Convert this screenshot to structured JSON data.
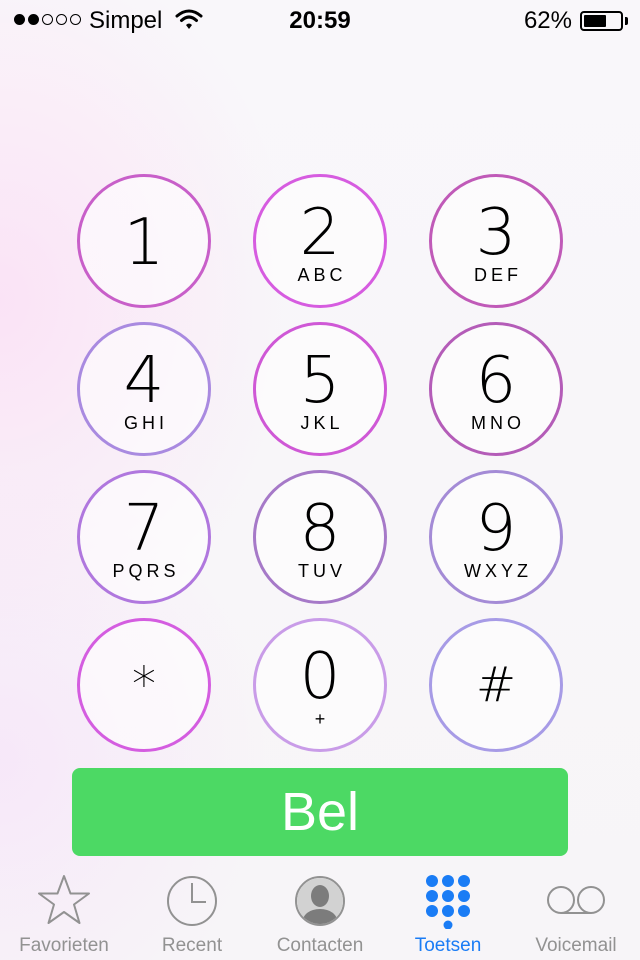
{
  "status_bar": {
    "signal_filled": 2,
    "signal_total": 5,
    "carrier": "Simpel",
    "time": "20:59",
    "battery_percent": "62%",
    "battery_level": 0.62
  },
  "keypad": [
    {
      "digit": "1",
      "letters": ""
    },
    {
      "digit": "2",
      "letters": "ABC"
    },
    {
      "digit": "3",
      "letters": "DEF"
    },
    {
      "digit": "4",
      "letters": "GHI"
    },
    {
      "digit": "5",
      "letters": "JKL"
    },
    {
      "digit": "6",
      "letters": "MNO"
    },
    {
      "digit": "7",
      "letters": "PQRS"
    },
    {
      "digit": "8",
      "letters": "TUV"
    },
    {
      "digit": "9",
      "letters": "WXYZ"
    },
    {
      "digit": "*",
      "letters": ""
    },
    {
      "digit": "0",
      "letters": "+"
    },
    {
      "digit": "#",
      "letters": ""
    }
  ],
  "call_button": {
    "label": "Bel",
    "color": "#4cd964"
  },
  "tab_bar": {
    "active_color": "#1a7cf5",
    "inactive_color": "#929292",
    "tabs": [
      {
        "label": "Favorieten",
        "icon": "star-icon",
        "active": false
      },
      {
        "label": "Recent",
        "icon": "clock-icon",
        "active": false
      },
      {
        "label": "Contacten",
        "icon": "contact-icon",
        "active": false
      },
      {
        "label": "Toetsen",
        "icon": "keypad-icon",
        "active": true
      },
      {
        "label": "Voicemail",
        "icon": "voicemail-icon",
        "active": false
      }
    ]
  }
}
